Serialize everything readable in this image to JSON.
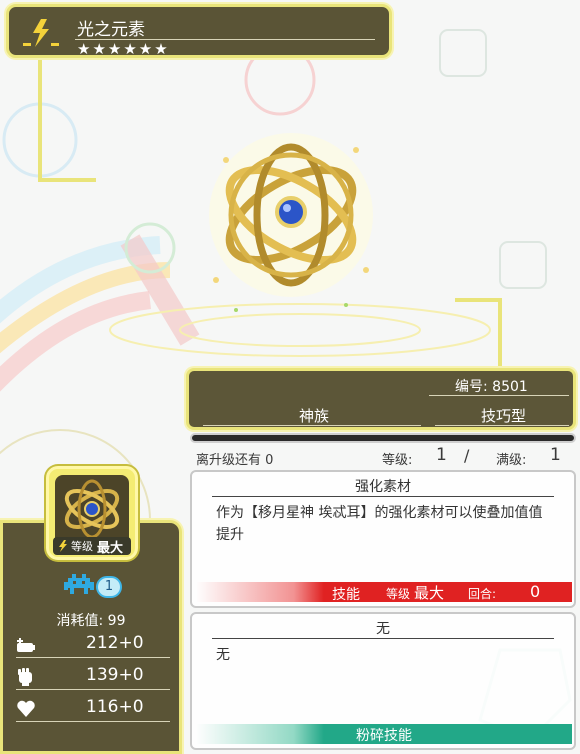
{
  "card": {
    "name": "光之元素",
    "stars": "★★★★★★",
    "number_label": "编号:",
    "number": "8501",
    "race": "神族",
    "type": "技巧型"
  },
  "level": {
    "next_label": "离升级还有",
    "next_value": "0",
    "level_label": "等级:",
    "level_value": "1",
    "slash": "/",
    "max_label": "满级:",
    "max_value": "1"
  },
  "thumb": {
    "level_label": "等级",
    "level_value": "最大"
  },
  "stats": {
    "space": "1",
    "cost_label": "消耗值:",
    "cost_value": "99",
    "hp": "212+0",
    "atk": "139+0",
    "rec": "116+0"
  },
  "skills": {
    "s1_title": "强化素材",
    "s1_desc": "作为【移月星神 埃忒耳】的强化素材可以使叠加值值提升",
    "s1_bar_skill": "技能",
    "s1_bar_level_label": "等级",
    "s1_bar_level_value": "最大",
    "s1_bar_turn_label": "回合:",
    "s1_bar_turn_value": "0",
    "s2_title": "无",
    "s2_desc": "无",
    "s2_bar": "粉碎技能"
  },
  "colors": {
    "panel_bg": "#5a5436",
    "panel_border": "#e9e47a",
    "skill_red": "#e02222",
    "skill_green": "#22a888"
  },
  "icons": {
    "element": "light-element-icon",
    "space": "invader-icon",
    "hp": "battery-icon",
    "atk": "fist-icon",
    "rec": "heart-icon"
  }
}
